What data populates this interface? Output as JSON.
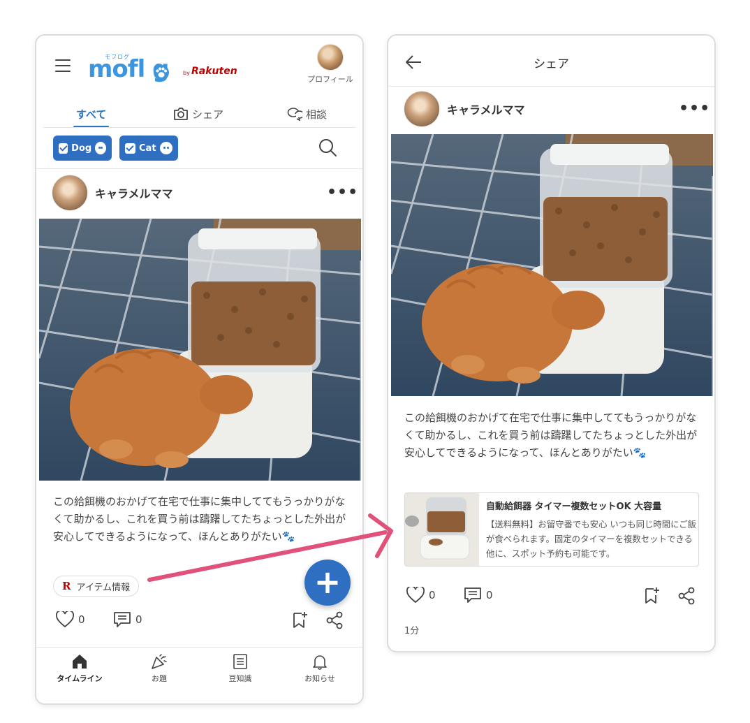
{
  "left": {
    "logo": {
      "sub": "モフログ",
      "main": "mofl g",
      "by": "by",
      "brand": "Rakuten"
    },
    "profile_label": "プロフィール",
    "tabs": [
      {
        "label": "すべて",
        "icon": "none"
      },
      {
        "label": "シェア",
        "icon": "camera-icon"
      },
      {
        "label": "相談",
        "icon": "chat-icon"
      }
    ],
    "filters": [
      {
        "label": "Dog",
        "checked": true,
        "icon": "dog-icon"
      },
      {
        "label": "Cat",
        "checked": true,
        "icon": "cat-icon"
      }
    ],
    "post": {
      "username": "キャラメルママ",
      "more": "•••",
      "caption": "この給餌機のおかげて在宅で仕事に集中しててもうっかりがなくて助かるし、これを買う前は躊躇してたちょっとした外出が安心してできるようになって、ほんとありがたい🐾",
      "item_chip": {
        "logo": "R",
        "label": "アイテム情報"
      },
      "likes": "0",
      "comments": "0"
    },
    "fab": "+",
    "bottom_nav": [
      {
        "label": "タイムライン",
        "icon": "home-icon",
        "active": true
      },
      {
        "label": "お題",
        "icon": "party-popper-icon",
        "active": false
      },
      {
        "label": "豆知識",
        "icon": "article-icon",
        "active": false
      },
      {
        "label": "お知らせ",
        "icon": "bell-icon",
        "active": false
      }
    ]
  },
  "right": {
    "title": "シェア",
    "post": {
      "username": "キャラメルママ",
      "more": "•••",
      "caption": "この給餌機のおかげて在宅で仕事に集中しててもうっかりがなくて助かるし、これを買う前は躊躇してたちょっとした外出が安心してできるようになって、ほんとありがたい🐾",
      "likes": "0",
      "comments": "0",
      "time": "1分"
    },
    "product": {
      "title": "自動給餌器 タイマー複数セットOK 大容量",
      "description": "【送料無料】お留守番でも安心 いつも同じ時間にご飯が食べられます。固定のタイマーを複数セットできる他に、スポット予約も可能です。"
    }
  },
  "colors": {
    "accent": "#2f6fc1",
    "brand_red": "#bf0000",
    "arrow": "#e0527a"
  }
}
